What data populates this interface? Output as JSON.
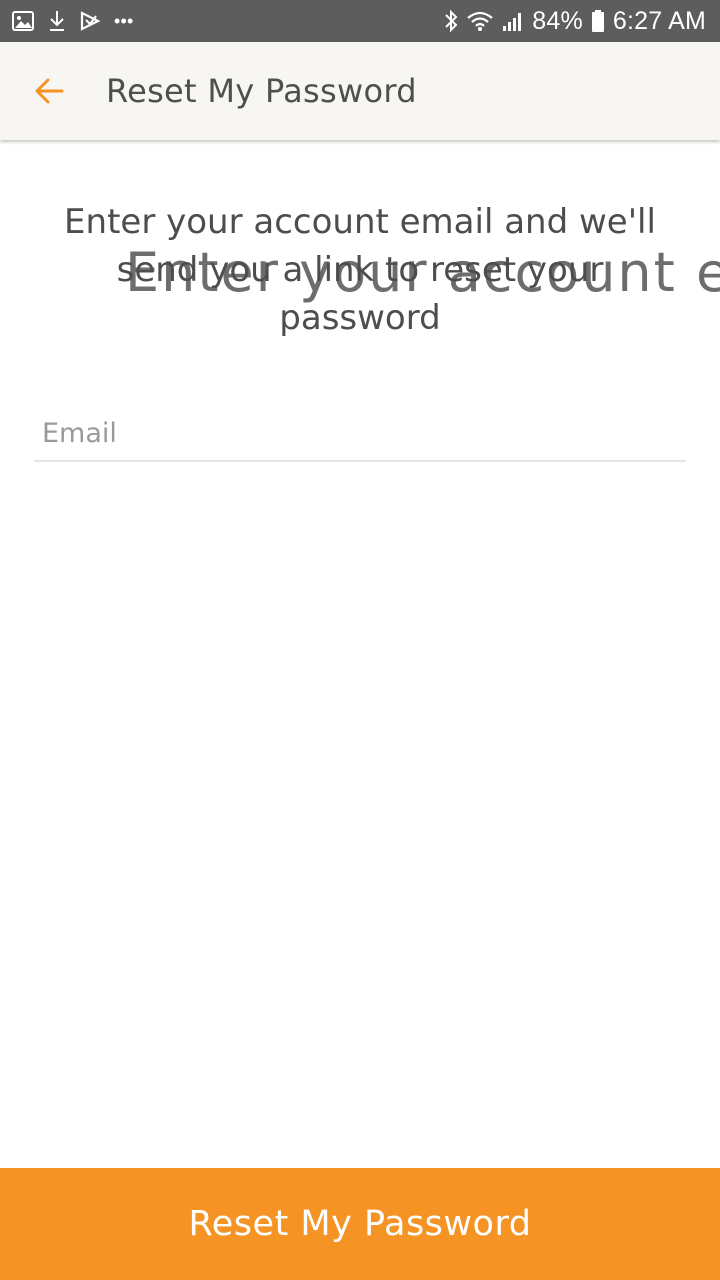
{
  "status_bar": {
    "battery_percent": "84%",
    "time": "6:27 AM",
    "more_indicator": "•••",
    "icons": [
      "image-icon",
      "download-icon",
      "play-store-icon",
      "more-dots-icon",
      "bluetooth-icon",
      "wifi-icon",
      "signal-icon",
      "battery-icon"
    ]
  },
  "app_bar": {
    "title": "Reset My Password",
    "back_icon": "arrow-left-icon"
  },
  "instructions": {
    "text": "Enter your account email and we'll send you a link to reset your password",
    "ghost_text": "Enter your account e"
  },
  "form": {
    "email_placeholder": "Email",
    "email_value": ""
  },
  "button": {
    "label": "Reset My Password"
  },
  "colors": {
    "accent": "#f59324",
    "status_bar": "#5d5d5d",
    "app_bar": "#f7f6f2",
    "text": "#4d4d4d"
  }
}
